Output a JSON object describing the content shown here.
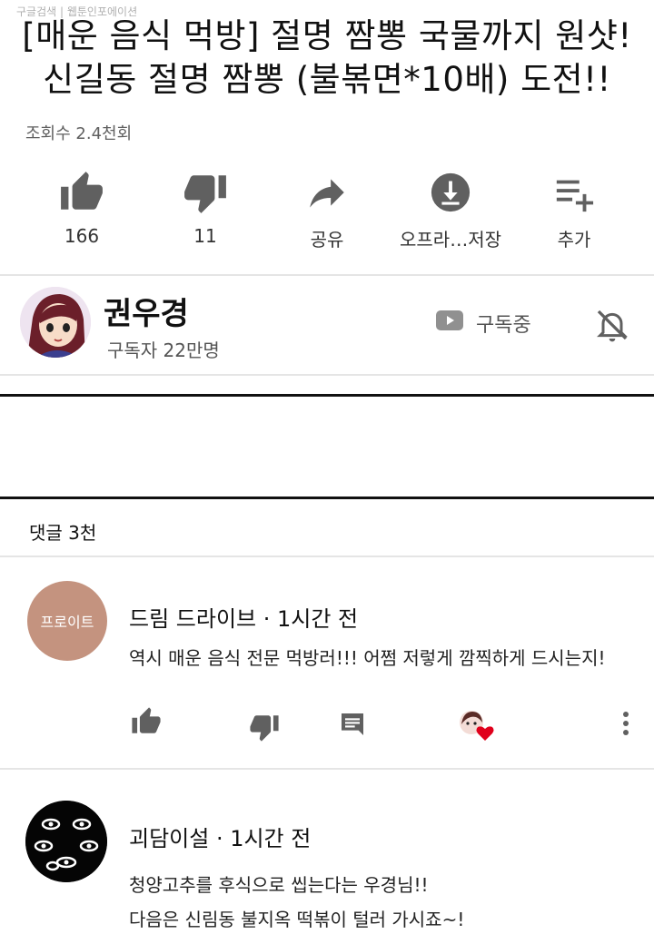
{
  "watermark": "구글검색 | 웹툰인포에이션",
  "video": {
    "title_line1": "[매운 음식 먹방] 절명 짬뽕 국물까지 원샷!",
    "title_line2": "신길동 절명 짬뽕 (불볶면*10배) 도전!!",
    "views": "조회수 2.4천회"
  },
  "actions": {
    "like_count": "166",
    "dislike_count": "11",
    "share_label": "공유",
    "offline_label": "오프라…저장",
    "add_label": "추가"
  },
  "channel": {
    "name": "권우경",
    "subscribers": "구독자 22만명",
    "subscribed_label": "구독중"
  },
  "comments": {
    "header": "댓글 3천",
    "items": [
      {
        "avatar_text": "프로이트",
        "author_line": "드림 드라이브 · 1시간 전",
        "text1": "역시 매운 음식 전문 먹방러!!! 어쩜 저렇게 깜찍하게 드시는지!",
        "text2": ""
      },
      {
        "avatar_text": "",
        "author_line": "괴담이설 · 1시간 전",
        "text1": "청양고추를 후식으로 씹는다는 우경님!!",
        "text2": "다음은 신림동 불지옥 떡볶이 털러 가시죠~!"
      }
    ]
  },
  "colors": {
    "icon_grey": "#606060",
    "heart_red": "#e0001b",
    "avatar_tan": "#c4937f"
  }
}
